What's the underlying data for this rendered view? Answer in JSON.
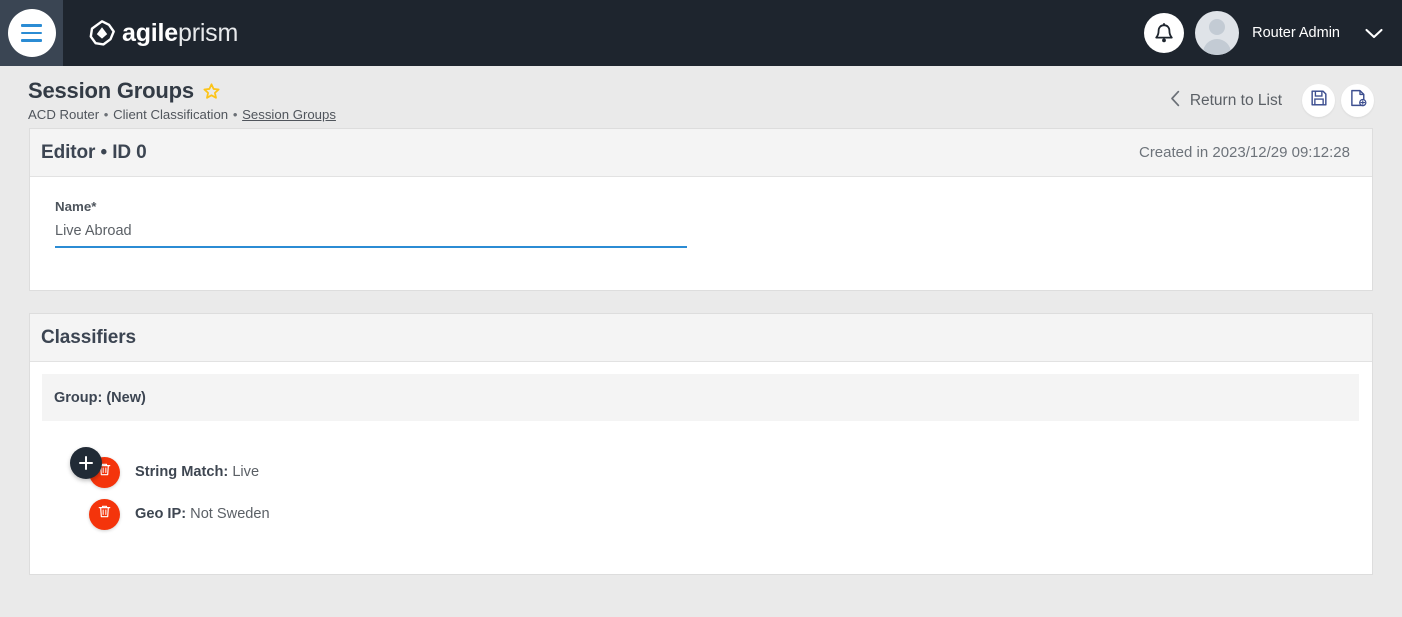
{
  "header": {
    "menu_icon": "hamburger-menu-icon",
    "brand_bold": "agile",
    "brand_light": "prism",
    "brand_logo_icon": "agileprism-logo-icon",
    "notification_icon": "bell-icon",
    "avatar_icon": "user-avatar-icon",
    "username": "Router Admin",
    "dropdown_icon": "chevron-down-icon"
  },
  "page": {
    "title": "Session Groups",
    "favorite_icon": "star-icon",
    "breadcrumb": {
      "root": "ACD Router",
      "sep": "•",
      "middle": "Client Classification",
      "current": "Session Groups"
    },
    "actions": {
      "back_icon": "chevron-left-icon",
      "return_label": "Return to List",
      "save_icon": "save-floppy-icon",
      "save_as_icon": "save-as-document-icon"
    }
  },
  "editor": {
    "heading": "Editor • ID 0",
    "created_label": "Created in 2023/12/29 09:12:28",
    "name_label": "Name",
    "name_required_mark": "*",
    "name_value": "Live Abroad",
    "name_placeholder": "Name"
  },
  "classifiers": {
    "heading": "Classifiers",
    "group_label": "Group: (New)",
    "add_icon": "plus-icon",
    "delete_icon": "trash-icon",
    "items": [
      {
        "type": "String Match:",
        "value": "Live"
      },
      {
        "type": "Geo IP:",
        "value": "Not Sweden"
      }
    ]
  },
  "colors": {
    "header_bg": "#1e252e",
    "sidebar_bg": "#3a4553",
    "accent_blue": "#2b8cd4",
    "delete_red": "#f4340b",
    "fab_dark": "#212b36",
    "star_gold": "#fcc419",
    "page_bg": "#eaeaea",
    "panel_head_bg": "#f4f4f4"
  }
}
